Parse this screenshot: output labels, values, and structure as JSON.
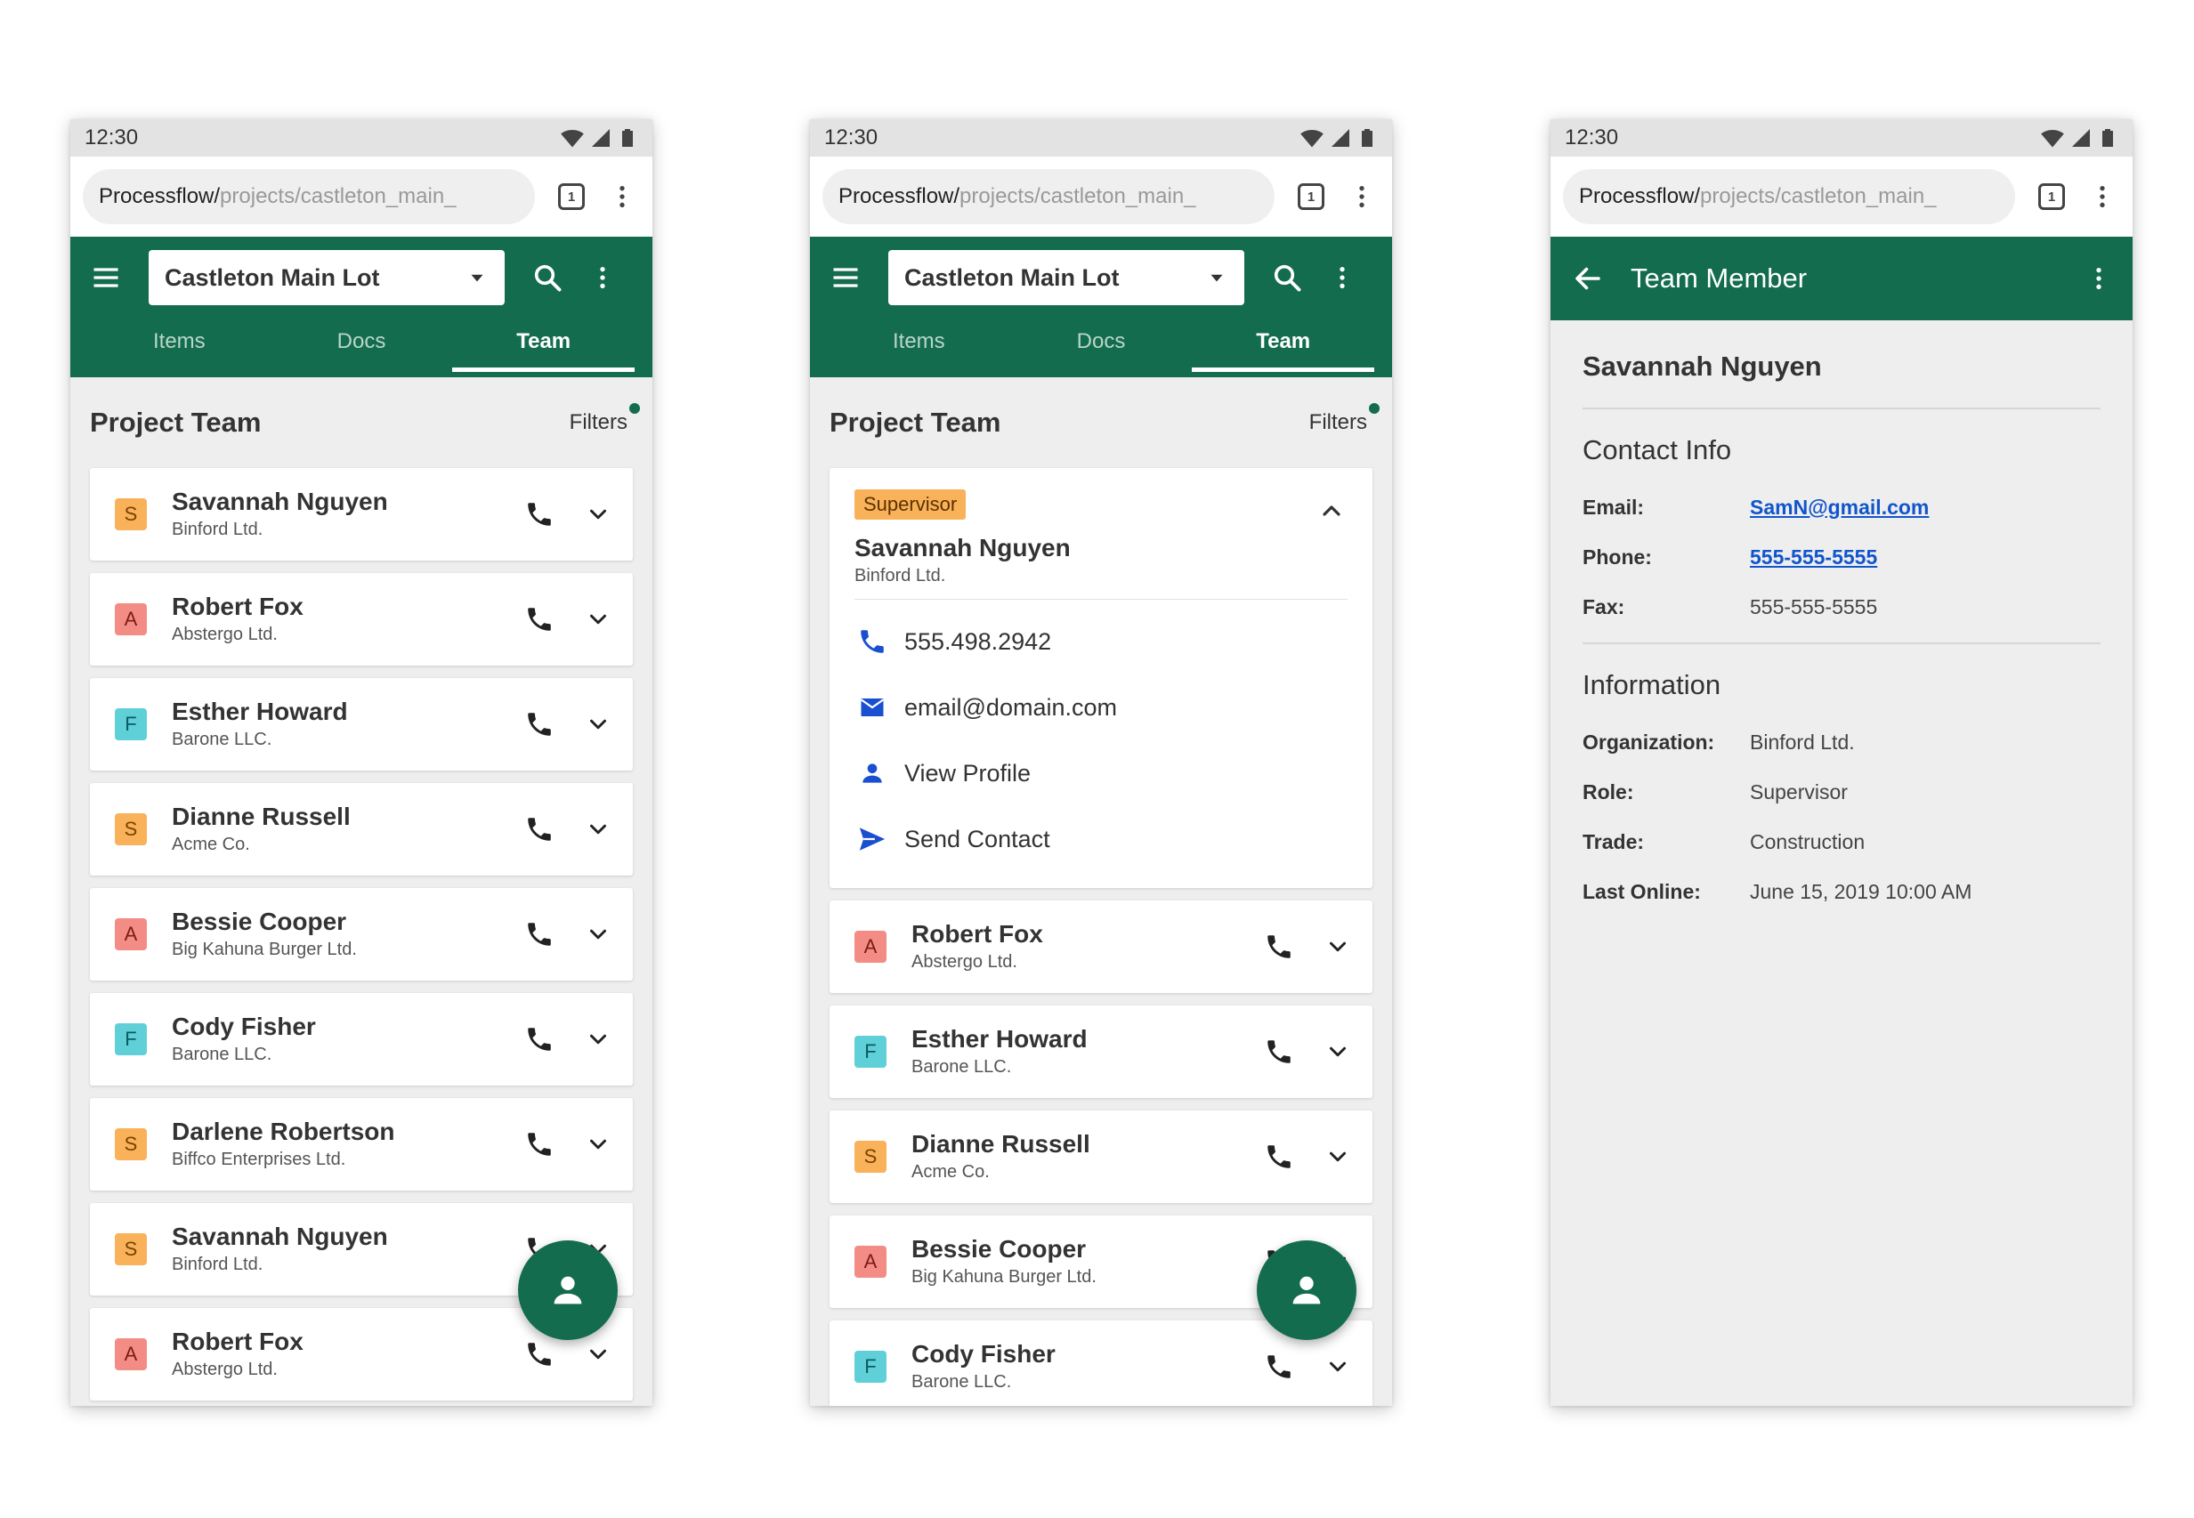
{
  "status": {
    "time": "12:30"
  },
  "browser": {
    "url_host": "Processflow/",
    "url_path": "projects/castleton_main_",
    "tab_count": "1"
  },
  "project_selector": {
    "value": "Castleton Main Lot"
  },
  "tabs": [
    "Items",
    "Docs",
    "Team"
  ],
  "list_header": {
    "title": "Project Team",
    "filters_label": "Filters"
  },
  "screen1": {
    "members": [
      {
        "initial": "S",
        "name": "Savannah Nguyen",
        "org": "Binford Ltd."
      },
      {
        "initial": "A",
        "name": "Robert Fox",
        "org": "Abstergo Ltd."
      },
      {
        "initial": "F",
        "name": "Esther Howard",
        "org": "Barone LLC."
      },
      {
        "initial": "S",
        "name": "Dianne Russell",
        "org": "Acme Co."
      },
      {
        "initial": "A",
        "name": "Bessie Cooper",
        "org": "Big Kahuna Burger Ltd."
      },
      {
        "initial": "F",
        "name": "Cody Fisher",
        "org": "Barone LLC."
      },
      {
        "initial": "S",
        "name": "Darlene Robertson",
        "org": "Biffco Enterprises Ltd."
      },
      {
        "initial": "S",
        "name": "Savannah Nguyen",
        "org": "Binford Ltd."
      },
      {
        "initial": "A",
        "name": "Robert Fox",
        "org": "Abstergo Ltd."
      }
    ]
  },
  "screen2": {
    "expanded": {
      "role": "Supervisor",
      "name": "Savannah Nguyen",
      "org": "Binford Ltd.",
      "phone": "555.498.2942",
      "email": "email@domain.com",
      "view_profile": "View Profile",
      "send_contact": "Send Contact"
    },
    "members": [
      {
        "initial": "A",
        "name": "Robert Fox",
        "org": "Abstergo Ltd."
      },
      {
        "initial": "F",
        "name": "Esther Howard",
        "org": "Barone LLC."
      },
      {
        "initial": "S",
        "name": "Dianne Russell",
        "org": "Acme Co."
      },
      {
        "initial": "A",
        "name": "Bessie Cooper",
        "org": "Big Kahuna Burger Ltd."
      },
      {
        "initial": "F",
        "name": "Cody Fisher",
        "org": "Barone LLC."
      }
    ]
  },
  "screen3": {
    "title": "Team Member",
    "name": "Savannah Nguyen",
    "contact_heading": "Contact Info",
    "contact": {
      "email_label": "Email:",
      "email": "SamN@gmail.com",
      "phone_label": "Phone:",
      "phone": "555-555-5555",
      "fax_label": "Fax:",
      "fax": "555-555-5555"
    },
    "info_heading": "Information",
    "info": {
      "org_label": "Organization:",
      "org": "Binford Ltd.",
      "role_label": "Role:",
      "role": "Supervisor",
      "trade_label": "Trade:",
      "trade": "Construction",
      "online_label": "Last Online:",
      "online": "June 15, 2019 10:00 AM"
    }
  },
  "colors": {
    "brand_green": "#136c4e",
    "badge_s": "#f9b15a",
    "badge_a": "#f48c86",
    "badge_f": "#5fd0d8",
    "link_blue": "#1155cc"
  },
  "icons": [
    "wifi-icon",
    "signal-icon",
    "battery-icon",
    "tabs-icon",
    "more-vert-icon",
    "menu-icon",
    "dropdown-arrow-icon",
    "search-icon",
    "phone-icon",
    "chevron-down-icon",
    "chevron-up-icon",
    "email-icon",
    "person-icon",
    "send-icon",
    "add-person-icon",
    "back-arrow-icon"
  ]
}
